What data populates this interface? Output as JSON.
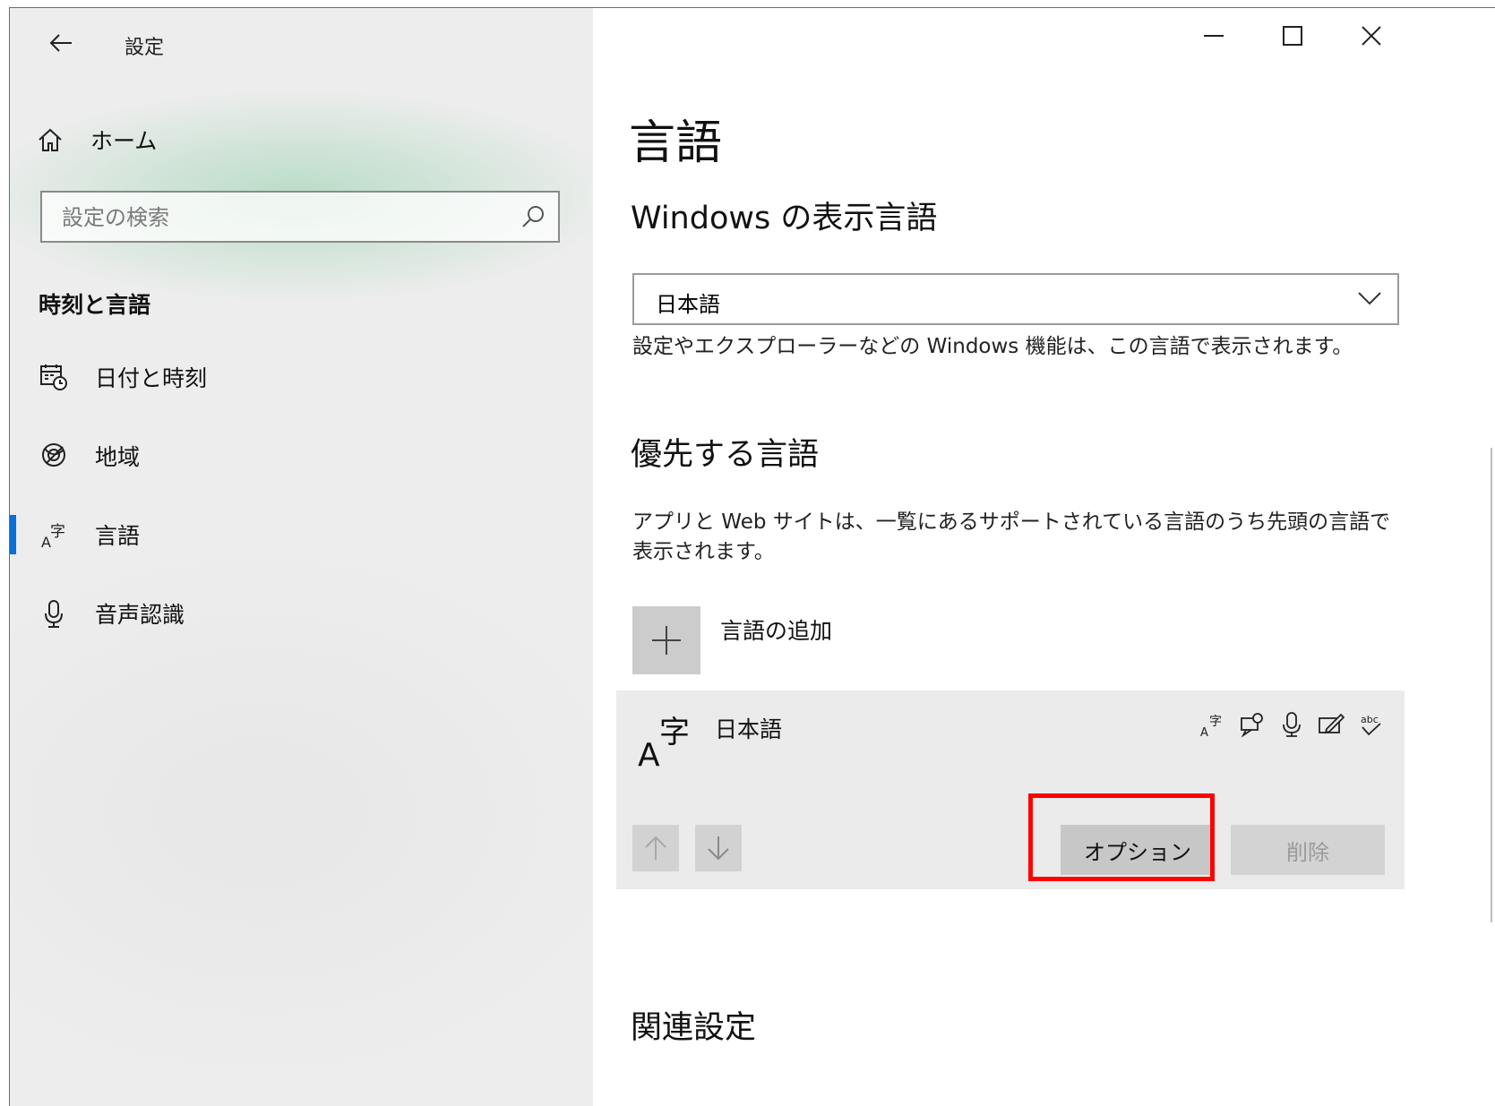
{
  "window": {
    "title": "設定",
    "controls": {
      "minimize": "minimize",
      "maximize": "maximize",
      "close": "close"
    }
  },
  "sidebar": {
    "home_label": "ホーム",
    "search": {
      "placeholder": "設定の検索"
    },
    "section_title": "時刻と言語",
    "items": [
      {
        "label": "日付と時刻",
        "icon": "calendar-clock-icon",
        "selected": false
      },
      {
        "label": "地域",
        "icon": "globe-icon",
        "selected": false
      },
      {
        "label": "言語",
        "icon": "language-icon",
        "selected": true
      },
      {
        "label": "音声認識",
        "icon": "microphone-icon",
        "selected": false
      }
    ],
    "accent_color": "#0a6fd6"
  },
  "main": {
    "title": "言語",
    "display_language": {
      "heading": "Windows の表示言語",
      "selected": "日本語",
      "description": "設定やエクスプローラーなどの Windows 機能は、この言語で表示されます。"
    },
    "preferred": {
      "heading": "優先する言語",
      "description": "アプリと Web サイトは、一覧にあるサポートされている言語のうち先頭の言語で表示されます。",
      "add_label": "言語の追加",
      "languages": [
        {
          "name": "日本語",
          "features": [
            "display-language-icon",
            "speech-icon",
            "microphone-icon",
            "handwriting-icon",
            "spellcheck-icon"
          ],
          "options_label": "オプション",
          "remove_label": "削除"
        }
      ]
    },
    "related_heading": "関連設定"
  },
  "highlight_color": "#ff0000"
}
